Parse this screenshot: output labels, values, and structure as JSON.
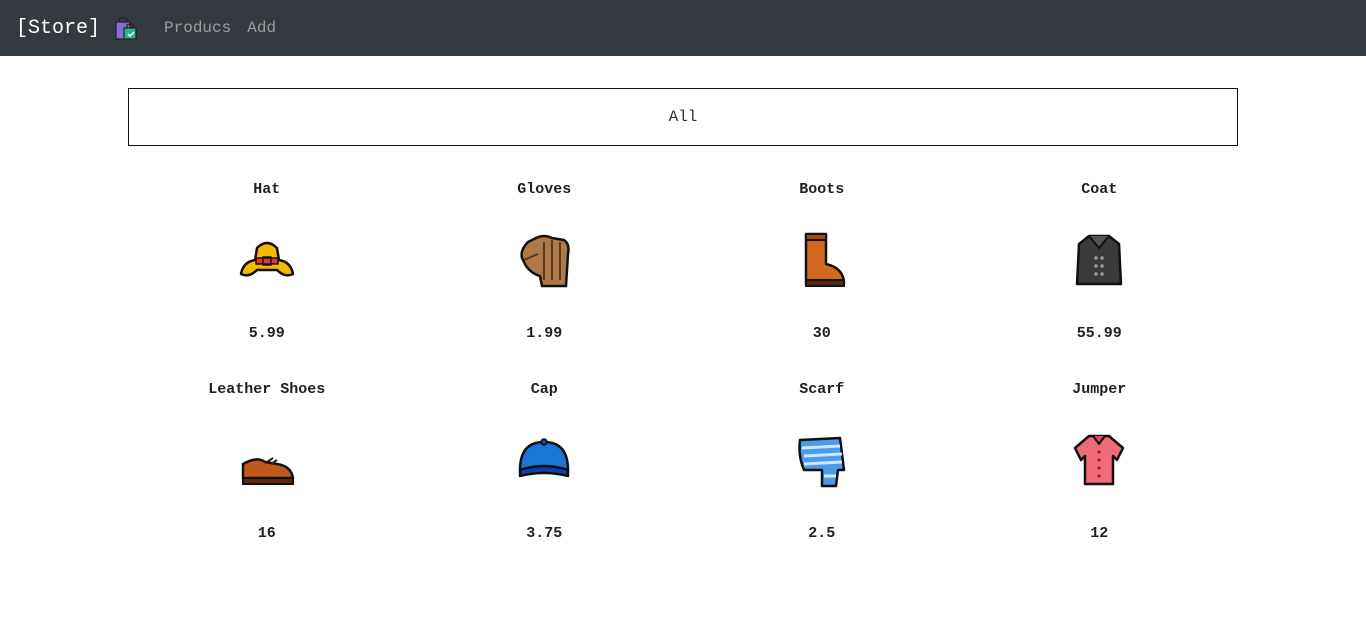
{
  "navbar": {
    "brand": "[Store]",
    "brand_icon": "shopping-bags-icon",
    "links": [
      "Producs",
      "Add"
    ]
  },
  "filter": {
    "label": "All"
  },
  "products": [
    {
      "name": "Hat",
      "price": "5.99",
      "icon": "hat-icon"
    },
    {
      "name": "Gloves",
      "price": "1.99",
      "icon": "gloves-icon"
    },
    {
      "name": "Boots",
      "price": "30",
      "icon": "boot-icon"
    },
    {
      "name": "Coat",
      "price": "55.99",
      "icon": "coat-icon"
    },
    {
      "name": "Leather Shoes",
      "price": "16",
      "icon": "shoe-icon"
    },
    {
      "name": "Cap",
      "price": "3.75",
      "icon": "cap-icon"
    },
    {
      "name": "Scarf",
      "price": "2.5",
      "icon": "scarf-icon"
    },
    {
      "name": "Jumper",
      "price": "12",
      "icon": "jumper-icon"
    }
  ]
}
